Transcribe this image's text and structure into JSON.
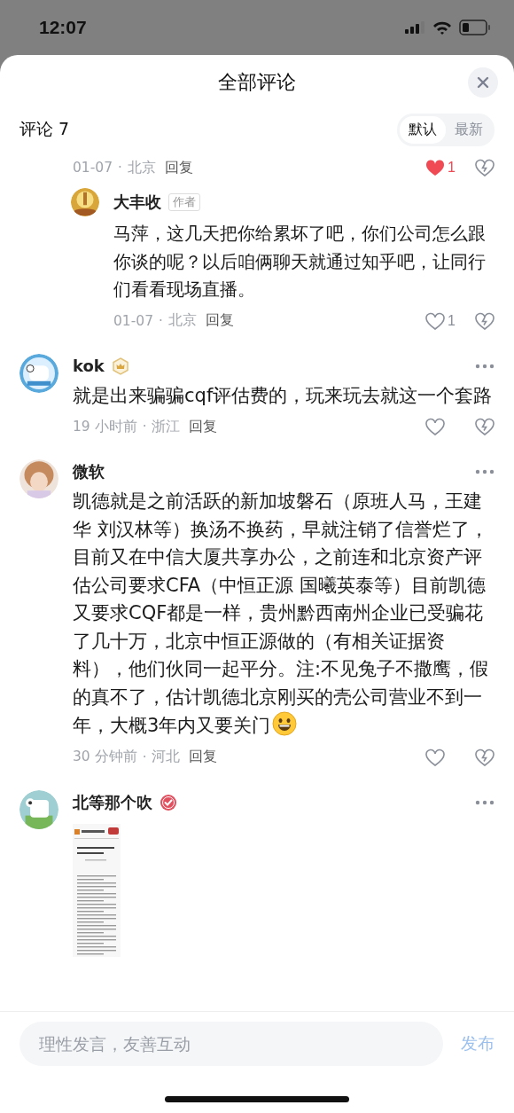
{
  "status_bar": {
    "time": "12:07"
  },
  "sheet": {
    "title": "全部评论"
  },
  "comments_header": {
    "label": "评论 7",
    "sort_tabs": [
      {
        "label": "默认",
        "selected": true
      },
      {
        "label": "最新",
        "selected": false
      }
    ]
  },
  "comments": [
    {
      "date": "01-07",
      "separator": "·",
      "location": "北京",
      "reply_label": "回复",
      "liked": true,
      "likes": "1",
      "replies": [
        {
          "author": "大丰收",
          "tag": "作者",
          "text": "马萍，这几天把你给累坏了吧，你们公司怎么跟你谈的呢？以后咱俩聊天就通过知乎吧，让同行们看看现场直播。",
          "date": "01-07",
          "separator": "·",
          "location": "北京",
          "reply_label": "回复",
          "liked": false,
          "likes": "1"
        }
      ]
    },
    {
      "author": "kok",
      "badge": {
        "kind": "crown"
      },
      "text": "就是出来骗骗cqf评估费的，玩来玩去就这一个套路",
      "date": "19 小时前",
      "separator": "·",
      "location": "浙江",
      "reply_label": "回复",
      "liked": false
    },
    {
      "author": "微软",
      "text": "凯德就是之前活跃的新加坡磐石（原班人马，王建华 刘汉林等）换汤不换药，早就注销了信誉烂了，目前又在中信大厦共享办公，之前连和北京资产评估公司要求CFA（中恒正源 国曦英泰等）目前凯德又要求CQF都是一样，贵州黔西南州企业已受骗花了几十万，北京中恒正源做的（有相关证据资料），他们伙同一起平分。注:不见兔子不撒鹰，假的真不了，估计凯德北京刚买的壳公司营业不到一年，大概3年内又要关门",
      "emoji": {
        "kind": "smile"
      },
      "date": "30 分钟前",
      "separator": "·",
      "location": "河北",
      "reply_label": "回复",
      "liked": false
    },
    {
      "author": "北等那个吹",
      "badge": {
        "kind": "verified"
      }
    }
  ],
  "composer": {
    "placeholder": "理性发言，友善互动",
    "send_label": "发布"
  }
}
